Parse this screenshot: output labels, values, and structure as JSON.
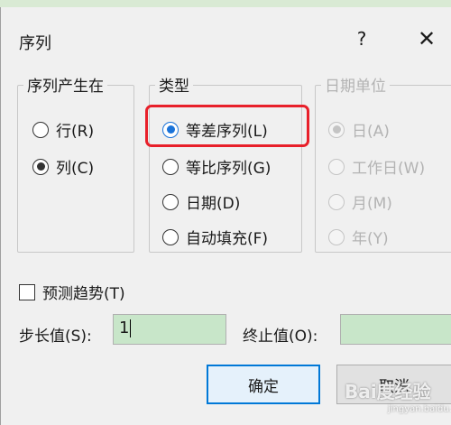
{
  "dialog": {
    "title": "序列",
    "help_label": "?",
    "close_label": "✕"
  },
  "series_in": {
    "legend": "序列产生在",
    "options": [
      {
        "label": "行(R)",
        "checked": false
      },
      {
        "label": "列(C)",
        "checked": true
      }
    ]
  },
  "type": {
    "legend": "类型",
    "options": [
      {
        "label": "等差序列(L)",
        "checked": true
      },
      {
        "label": "等比序列(G)",
        "checked": false
      },
      {
        "label": "日期(D)",
        "checked": false
      },
      {
        "label": "自动填充(F)",
        "checked": false
      }
    ]
  },
  "date_unit": {
    "legend": "日期单位",
    "disabled": true,
    "options": [
      {
        "label": "日(A)",
        "checked": true
      },
      {
        "label": "工作日(W)",
        "checked": false
      },
      {
        "label": "月(M)",
        "checked": false
      },
      {
        "label": "年(Y)",
        "checked": false
      }
    ]
  },
  "trend": {
    "label": "预测趋势(T)",
    "checked": false
  },
  "step": {
    "label": "步长值(S):",
    "value": "1"
  },
  "stop": {
    "label": "终止值(O):",
    "value": ""
  },
  "buttons": {
    "ok": "确定",
    "cancel": "取消"
  },
  "watermark": {
    "text": "Bai度经验",
    "sub": "jingyan.baidu.com"
  },
  "colors": {
    "accent": "#1a73d9",
    "highlight": "#e8202a",
    "input_bg": "#c8e6c9"
  }
}
